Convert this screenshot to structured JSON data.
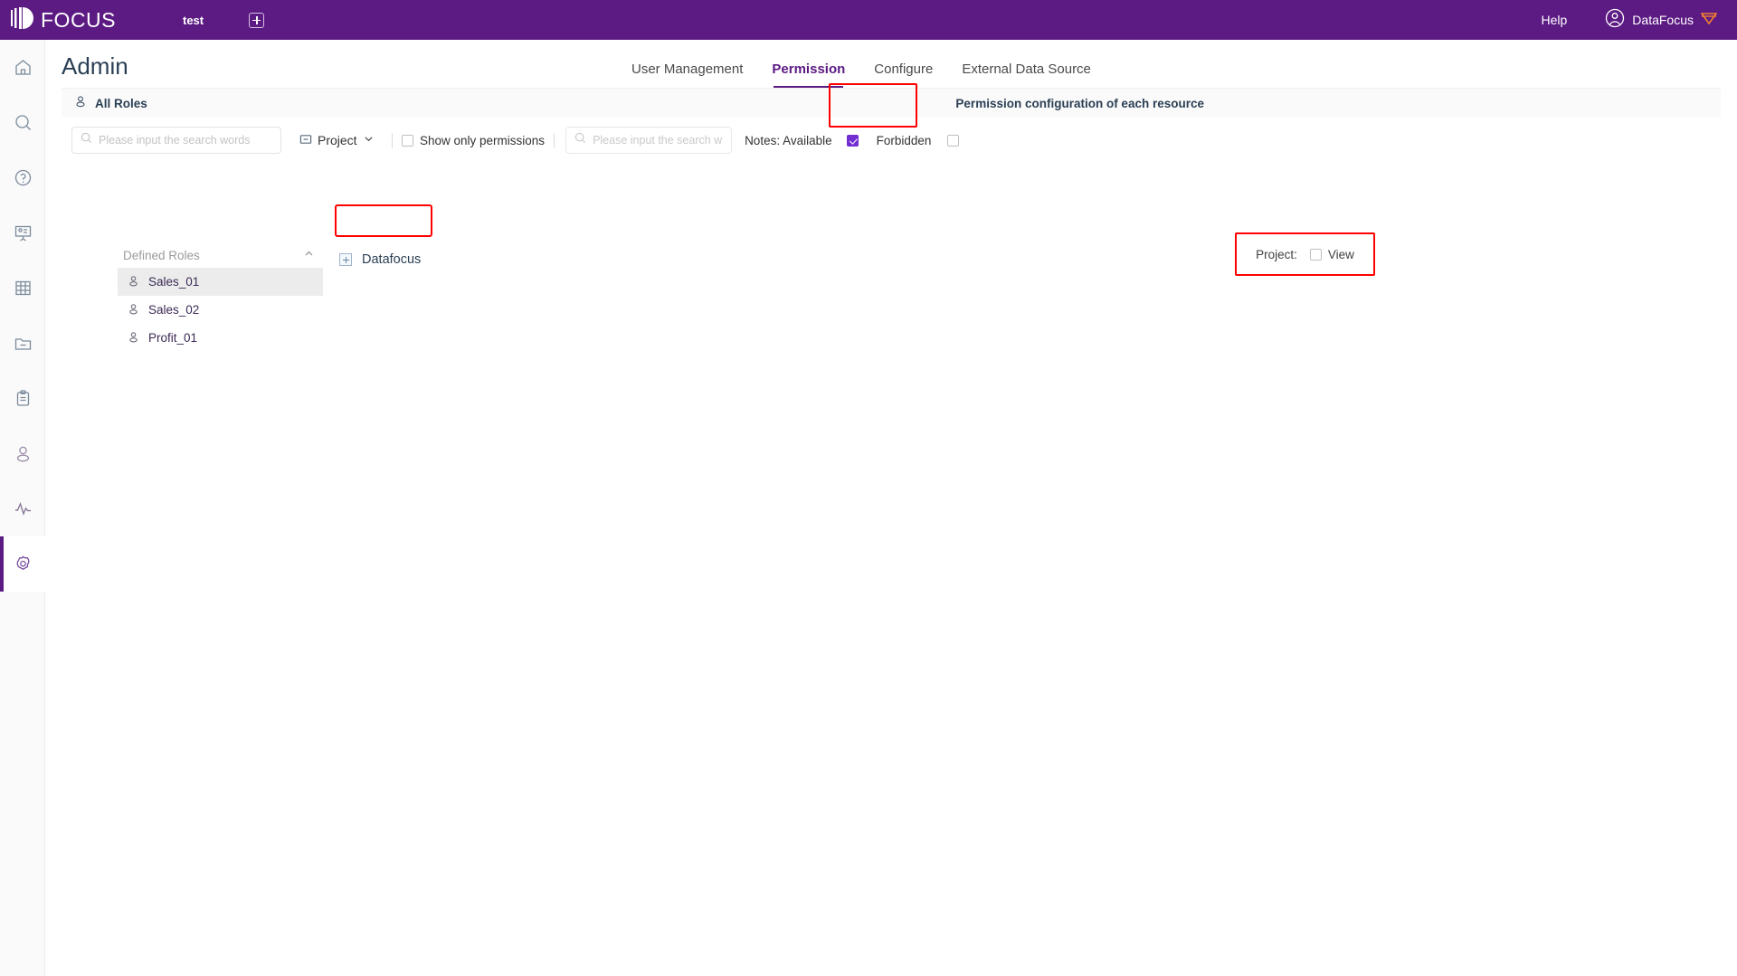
{
  "header": {
    "logo_text": "FOCUS",
    "logo_icon": "focus-logo-icon",
    "workspace_tab": "test",
    "add_tab_icon": "plus-square-icon",
    "help": "Help",
    "user_icon": "user-circle-icon",
    "user_name": "DataFocus",
    "crown_icon": "crown-icon",
    "bg_color": "#5c1a83"
  },
  "rail": {
    "items": [
      {
        "name": "home-icon",
        "active": false
      },
      {
        "name": "search-icon",
        "active": false
      },
      {
        "name": "help-circle-icon",
        "active": false
      },
      {
        "name": "presentation-icon",
        "active": false
      },
      {
        "name": "table-grid-icon",
        "active": false
      },
      {
        "name": "folder-minus-icon",
        "active": false
      },
      {
        "name": "clipboard-icon",
        "active": false
      },
      {
        "name": "user-icon",
        "active": false
      },
      {
        "name": "activity-icon",
        "active": false
      },
      {
        "name": "gear-icon",
        "active": true
      }
    ]
  },
  "page": {
    "title": "Admin",
    "tabs": [
      {
        "label": "User Management",
        "active": false
      },
      {
        "label": "Permission",
        "active": true
      },
      {
        "label": "Configure",
        "active": false
      },
      {
        "label": "External Data Source",
        "active": false
      }
    ]
  },
  "band": {
    "left_icon": "user-icon",
    "left_title": "All Roles",
    "right_title": "Permission configuration of each resource"
  },
  "toolbar": {
    "role_search_placeholder": "Please input the search words",
    "role_search_value": "",
    "search_icon": "search-icon",
    "project_select": {
      "icon": "folder-minus-icon",
      "label": "Project",
      "chevron": "chevron-down-icon"
    },
    "show_only_permissions": {
      "label": "Show only permissions",
      "checked": false
    },
    "resource_search_placeholder": "Please input the search w",
    "resource_search_value": "",
    "notes_label": "Notes: Available",
    "available_checked": true,
    "forbidden_label": "Forbidden",
    "forbidden_checked": false,
    "accent_color": "#722ed1"
  },
  "roles": {
    "group_label": "Defined Roles",
    "collapse_icon": "chevron-up-icon",
    "items": [
      {
        "name": "Sales_01",
        "icon": "user-icon",
        "selected": true
      },
      {
        "name": "Sales_02",
        "icon": "user-icon",
        "selected": false
      },
      {
        "name": "Profit_01",
        "icon": "user-icon",
        "selected": false
      }
    ]
  },
  "tree": {
    "expander_icon": "expand-plus-icon",
    "label": "Datafocus"
  },
  "permission_panel": {
    "key": "Project:",
    "checkbox_checked": false,
    "value": "View",
    "highlight_color": "#ff0000"
  }
}
